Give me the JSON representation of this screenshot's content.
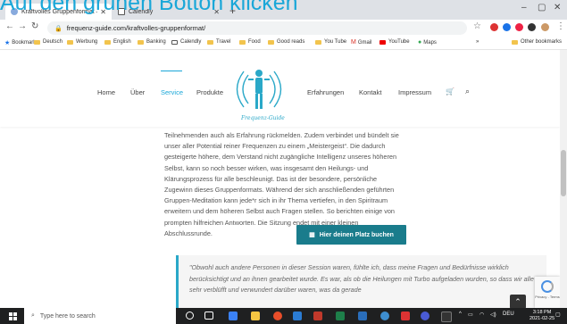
{
  "overlay": {
    "heading": "Auf den grünen Botton klicken"
  },
  "browser": {
    "tabs": [
      {
        "title": "Kraftvolles Gruppenformat – Frequ",
        "active": true
      },
      {
        "title": "Calendly",
        "active": false
      }
    ],
    "url": "frequenz-guide.com/kraftvolles-gruppenformat/",
    "bookmarks": [
      "Bookmarks",
      "Deutsch",
      "Werbung",
      "English",
      "Banking",
      "Calendly",
      "Travel",
      "Food",
      "Good reads",
      "You Tube",
      "Gmail",
      "YouTube",
      "Maps"
    ],
    "other_bookmarks": "Other bookmarks"
  },
  "site": {
    "nav": [
      "Home",
      "Über",
      "Service",
      "Produkte",
      "Erfahrungen",
      "Kontakt",
      "Impressum"
    ],
    "active_nav": "Service",
    "logo_text": "Frequenz-Guide"
  },
  "content": {
    "paragraph": "Teilnehmenden auch als Erfahrung rückmelden. Zudem verbindet und bündelt sie unser aller Potential reiner Frequenzen zu einem „Meistergeist“. Die dadurch gesteigerte höhere, dem Verstand nicht zugängliche Intelligenz unseres höheren Selbst, kann so noch besser wirken, was insgesamt den Heilungs- und Klärungsprozess für alle beschleunigt. Das ist der besondere, persönliche Zugewinn dieses Gruppenformats. Während der sich anschließenden geführten Gruppen-Meditation kann jede*r sich in ihr Thema vertiefen, in den Spiritraum erweitern und dem höheren Selbst auch Fragen stellen. So berichten einige von prompten hilfreichen Antworten. Die Sitzung endet mit einer kleinen Abschlussrunde.",
    "cta_label": "Hier deinen Platz buchen",
    "quote": "\"Obwohl auch andere Personen in dieser Session waren, fühlte ich, dass meine Fragen und Bedürfnisse wirklich berücksichtigt und an ihnen gearbeitet wurde. Es war, als ob die Heilungen mit Turbo aufgeladen wurden, so dass wir alle sehr verblüfft und verwundert darüber waren, was da gerade"
  },
  "widgets": {
    "captcha_label": "Privacy - Terms"
  },
  "taskbar": {
    "search_placeholder": "Type here to search",
    "lang": "DEU",
    "time": "3:18 PM",
    "date": "2021-02-25"
  },
  "colors": {
    "accent": "#1aa7d8",
    "cta": "#1a7c8c",
    "taskbar": "#1f2021"
  },
  "icons": [
    "back-icon",
    "forward-icon",
    "reload-icon",
    "lock-icon",
    "star-icon",
    "cart-icon",
    "search-icon",
    "calendar-icon",
    "chevron-up-icon",
    "windows-icon"
  ]
}
